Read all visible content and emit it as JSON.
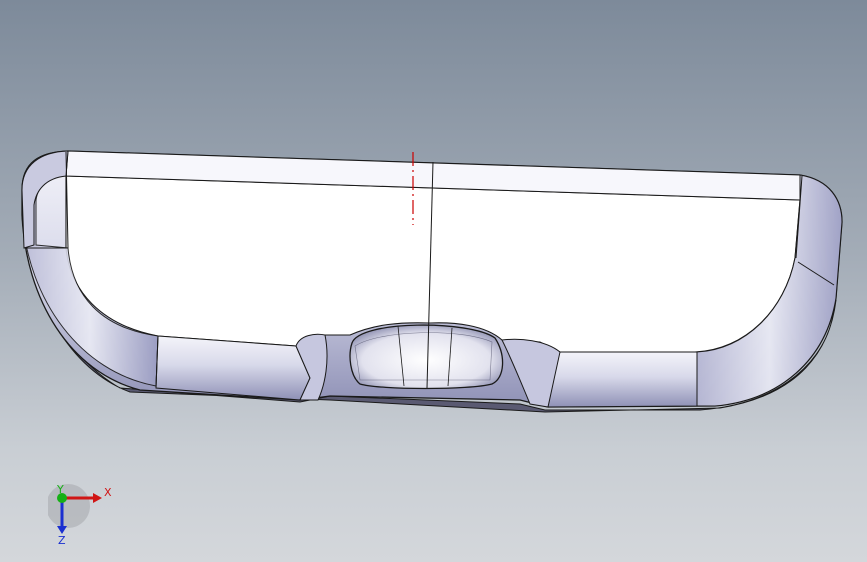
{
  "viewport": {
    "background_top": "#7d8a9a",
    "background_bottom": "#d4d7db"
  },
  "model": {
    "face_color": "#ffffff",
    "edge_color": "#1a1a1a",
    "shade_color": "#9a9cc0",
    "centerline_color": "#cc0000"
  },
  "triad": {
    "x_label": "X",
    "y_label": "Y",
    "z_label": "Z",
    "x_color": "#d01515",
    "y_color": "#16b016",
    "z_color": "#1a2fd0"
  }
}
